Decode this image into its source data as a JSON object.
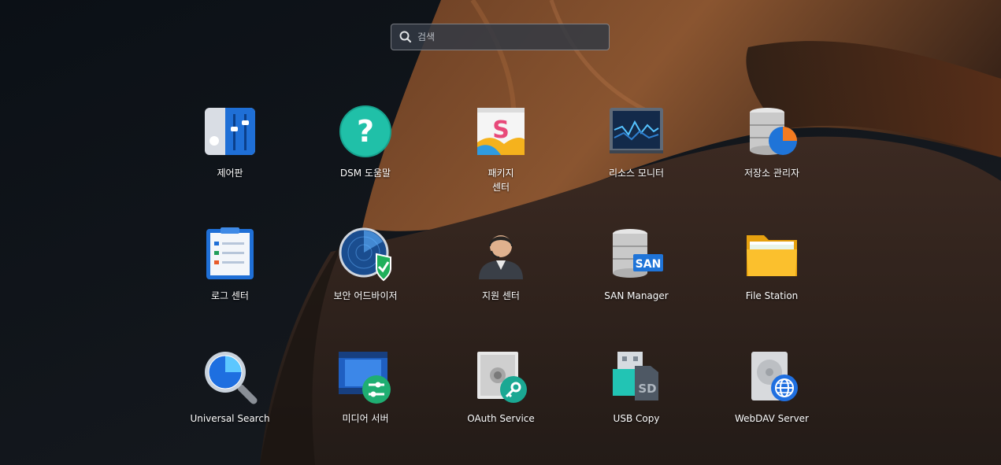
{
  "search": {
    "placeholder": "검색"
  },
  "apps": [
    {
      "label": "제어판",
      "icon": "control-panel-icon"
    },
    {
      "label": "DSM 도움말",
      "icon": "help-icon"
    },
    {
      "label": "패키지\n센터",
      "icon": "package-center-icon"
    },
    {
      "label": "리소스 모니터",
      "icon": "resource-monitor-icon"
    },
    {
      "label": "저장소 관리자",
      "icon": "storage-manager-icon"
    },
    {
      "label": "로그 센터",
      "icon": "log-center-icon"
    },
    {
      "label": "보안 어드바이저",
      "icon": "security-advisor-icon"
    },
    {
      "label": "지원 센터",
      "icon": "support-center-icon"
    },
    {
      "label": "SAN Manager",
      "icon": "san-manager-icon"
    },
    {
      "label": "File Station",
      "icon": "file-station-icon"
    },
    {
      "label": "Universal Search",
      "icon": "universal-search-icon"
    },
    {
      "label": "미디어 서버",
      "icon": "media-server-icon"
    },
    {
      "label": "OAuth Service",
      "icon": "oauth-service-icon"
    },
    {
      "label": "USB Copy",
      "icon": "usb-copy-icon"
    },
    {
      "label": "WebDAV Server",
      "icon": "webdav-server-icon"
    }
  ]
}
